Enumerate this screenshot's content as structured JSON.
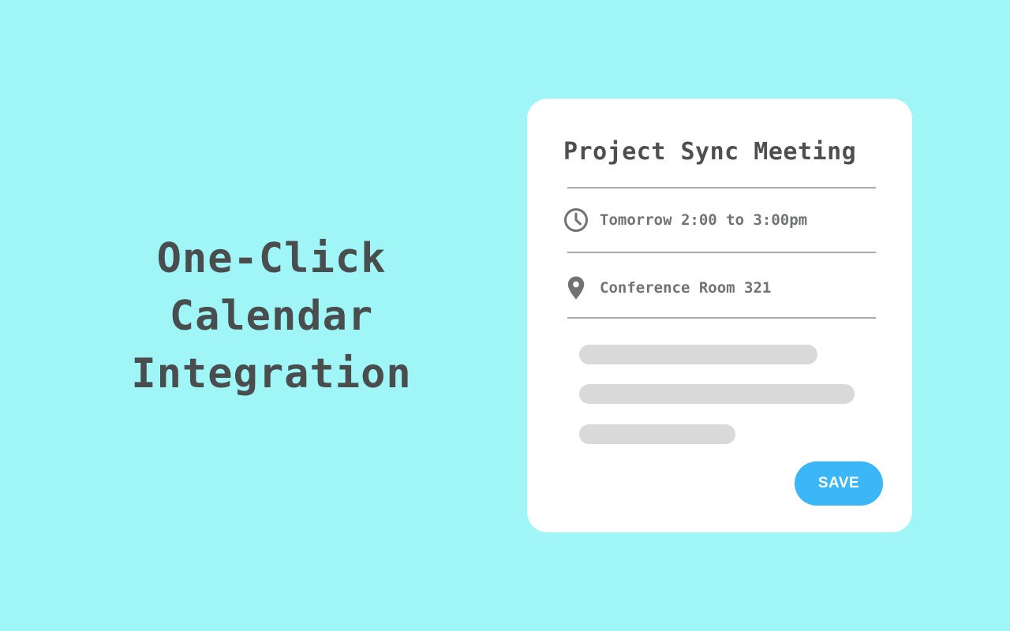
{
  "headline": {
    "lines": [
      "One-Click",
      "Calendar",
      "Integration"
    ]
  },
  "event_card": {
    "title": "Project Sync Meeting",
    "time": {
      "icon": "clock-icon",
      "text": "Tomorrow 2:00 to 3:00pm"
    },
    "location": {
      "icon": "map-pin-icon",
      "text": "Conference Room 321"
    },
    "save_label": "SAVE"
  },
  "colors": {
    "background": "#a0f5f7",
    "card": "#ffffff",
    "heading_text": "#4a4d4e",
    "detail_text": "#707273",
    "divider": "#aaaaaa",
    "placeholder": "#d9d9d9",
    "accent": "#3bb6f7"
  }
}
